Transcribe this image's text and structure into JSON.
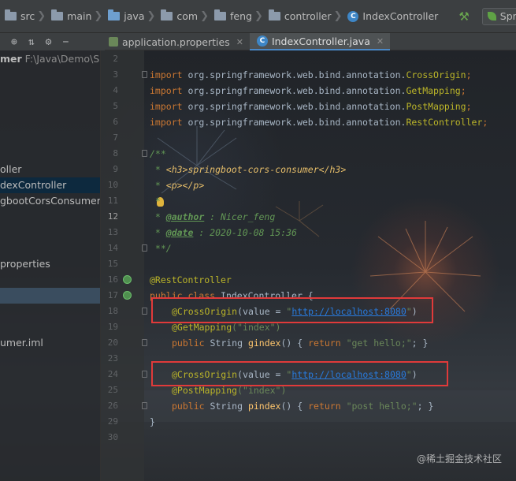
{
  "breadcrumb": [
    "src",
    "main",
    "java",
    "com",
    "feng",
    "controller",
    "IndexController"
  ],
  "run_config": "SpringbootC",
  "tabs": [
    {
      "label": "application.properties",
      "active": false
    },
    {
      "label": "IndexController.java",
      "active": true
    }
  ],
  "project": {
    "name_fragment": "mer",
    "path": "F:\\Java\\Demo\\Spr",
    "items": [
      "oller",
      "dexController",
      "gbootCorsConsumerAp",
      "properties",
      "umer.iml"
    ]
  },
  "line_numbers": [
    "2",
    "3",
    "4",
    "5",
    "6",
    "7",
    "8",
    "9",
    "10",
    "11",
    "12",
    "13",
    "14",
    "15",
    "16",
    "17",
    "18",
    "19",
    "20",
    "23",
    "24",
    "25",
    "26",
    "29",
    "30"
  ],
  "code": {
    "imports": [
      {
        "kw": "import",
        "pkg": "org.springframework.web.bind.annotation.",
        "cls": "CrossOrigin",
        "end": ";"
      },
      {
        "kw": "import",
        "pkg": "org.springframework.web.bind.annotation.",
        "cls": "GetMapping",
        "end": ";"
      },
      {
        "kw": "import",
        "pkg": "org.springframework.web.bind.annotation.",
        "cls": "PostMapping",
        "end": ";"
      },
      {
        "kw": "import",
        "pkg": "org.springframework.web.bind.annotation.",
        "cls": "RestController",
        "end": ";"
      }
    ],
    "doc_open": "/**",
    "doc_h3_star": " * ",
    "doc_h3": "<h3>springboot-cors-consumer</h3>",
    "doc_p_star": " * ",
    "doc_p": "<p></p>",
    "doc_star": " *",
    "doc_author_star": " * ",
    "doc_author_tag": "@author",
    "doc_author_val": " : Nicer_feng",
    "doc_date_star": " * ",
    "doc_date_tag": "@date",
    "doc_date_val": " : 2020-10-08 15:36",
    "doc_close": " **/",
    "rest_controller": "@RestController",
    "class_kw": "public class ",
    "class_name": "IndexController {",
    "cross1_ann": "@CrossOrigin",
    "cross_open": "(value = ",
    "cross_url": "http://localhost:8080",
    "cross_close": ")",
    "get_ann": "@GetMapping",
    "get_arg": "(\"index\")",
    "pub": "public ",
    "string": "String ",
    "gindex": "gindex",
    "gindex_body_a": "() { ",
    "ret": "return ",
    "get_str": "\"get hello;\"",
    "gindex_body_b": "; }",
    "cross2_ann": "@CrossOrigin",
    "post_ann": "@PostMapping",
    "post_arg": "(\"index\")",
    "pindex": "pindex",
    "post_str": "\"post hello;\"",
    "close_brace": "}"
  },
  "watermark": "@稀土掘金技术社区",
  "colors": {
    "highlight_box": "#e03a3a",
    "keyword": "#cc7832",
    "annotation": "#bbb529",
    "comment": "#629755",
    "string": "#6a8759",
    "link": "#287bde"
  }
}
